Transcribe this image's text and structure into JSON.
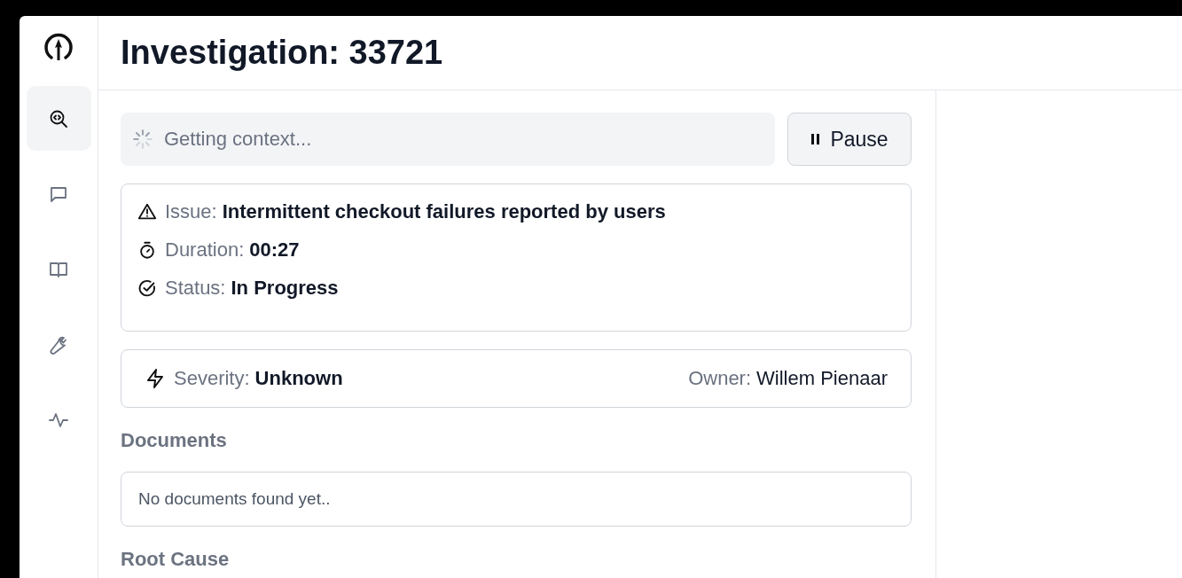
{
  "title": "Investigation: 33721",
  "sidebar": {
    "items": [
      {
        "kind": "search",
        "selected": true
      },
      {
        "kind": "chat",
        "selected": false
      },
      {
        "kind": "book",
        "selected": false
      },
      {
        "kind": "wrench",
        "selected": false
      },
      {
        "kind": "pulse",
        "selected": false
      }
    ]
  },
  "progress": {
    "text": "Getting context..."
  },
  "pause_button": {
    "label": "Pause"
  },
  "summary": [
    {
      "kind": "issue",
      "label": "Issue:",
      "value": "Intermittent checkout failures reported by users"
    },
    {
      "kind": "duration",
      "label": "Duration:",
      "value": "00:27"
    },
    {
      "kind": "status",
      "label": "Status:",
      "value": "In Progress"
    }
  ],
  "meta": {
    "severity": {
      "label": "Severity:",
      "value": "Unknown"
    },
    "owner": {
      "label": "Owner:",
      "value": "Willem Pienaar"
    }
  },
  "documents": {
    "heading": "Documents",
    "empty_text": "No documents found yet.."
  },
  "root_cause": {
    "heading": "Root Cause"
  }
}
